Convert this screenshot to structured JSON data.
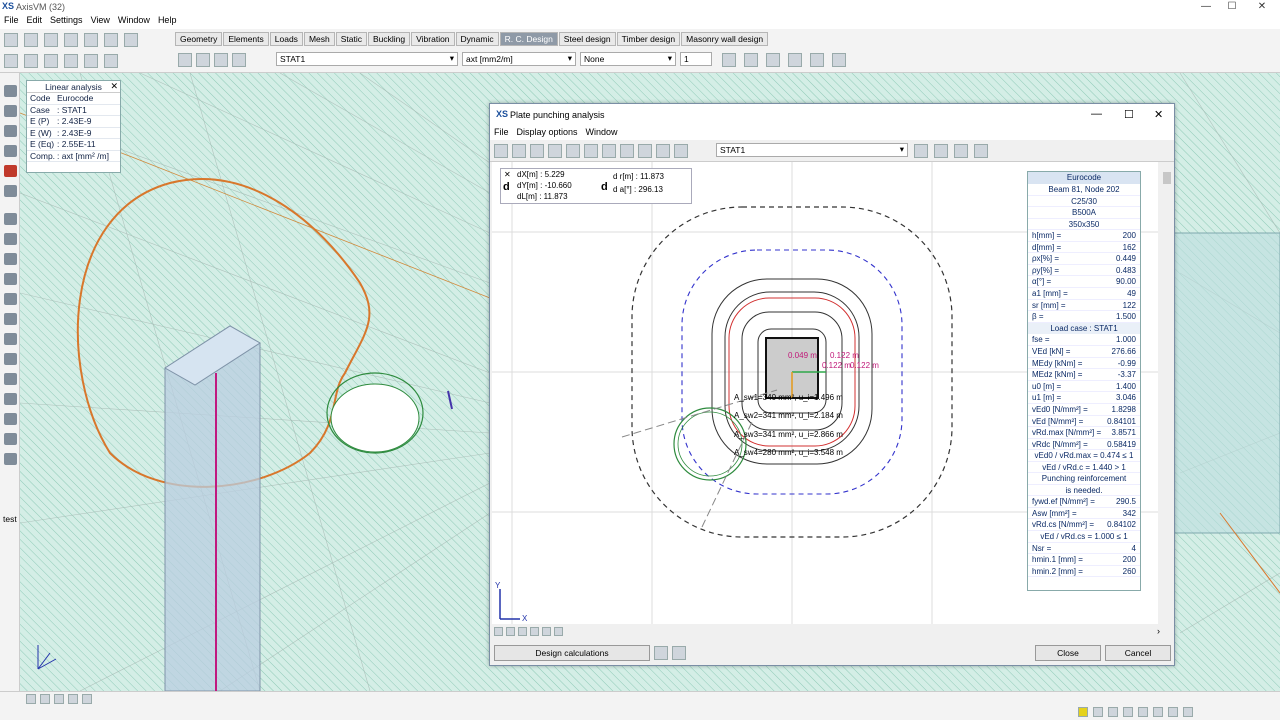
{
  "app": {
    "title": "AxisVM (32)",
    "window_buttons": [
      "—",
      "☐",
      "✕"
    ]
  },
  "menu": [
    "File",
    "Edit",
    "Settings",
    "View",
    "Window",
    "Help"
  ],
  "tabs": [
    "Geometry",
    "Elements",
    "Loads",
    "Mesh",
    "Static",
    "Buckling",
    "Vibration",
    "Dynamic",
    "R. C. Design",
    "Steel design",
    "Timber design",
    "Masonry wall design"
  ],
  "active_tab": "R. C. Design",
  "toolbar": {
    "case_select": "STAT1",
    "component_select": "axt [mm2/m]",
    "option_select": "None",
    "spinner": "1"
  },
  "left_label": "test",
  "info": {
    "title": "Linear analysis",
    "rows": [
      {
        "k": "Code",
        "v": "Eurocode"
      },
      {
        "k": "Case",
        "v": ": STAT1"
      },
      {
        "k": "E (P)",
        "v": ": 2.43E-9"
      },
      {
        "k": "E (W)",
        "v": ": 2.43E-9"
      },
      {
        "k": "E (Eq)",
        "v": ": 2.55E-11"
      },
      {
        "k": "Comp.",
        "v": ": axt [mm² /m]"
      }
    ]
  },
  "dialog": {
    "title": "Plate punching analysis",
    "menu": [
      "File",
      "Display options",
      "Window"
    ],
    "case_select": "STAT1",
    "delta": {
      "dx": "dX[m] : 5.229",
      "dy": "dY[m] : -10.660",
      "dl": "dL[m] : 11.873",
      "dr": "d r[m] : 11.873",
      "da": "d a[°] : 296.13"
    },
    "labels": {
      "v1": "0.049 m",
      "v2": "0.122 m",
      "v3": "0.122 m",
      "v4": "0.122 m",
      "a1": "A_sw1=340 mm², u_i=1.496 m",
      "a2": "A_sw2=341 mm², u_i=2.184 m",
      "a3": "A_sw3=341 mm², u_i=2.866 m",
      "a4": "A_sw4=280 mm², u_i=3.548 m"
    },
    "axes": {
      "x": "X",
      "y": "Y"
    },
    "results": {
      "header": "Eurocode",
      "info": [
        "Beam 81, Node 202",
        "C25/30",
        "B500A",
        "350x350"
      ],
      "params": [
        [
          "h[mm] =",
          "200"
        ],
        [
          "d[mm] =",
          "162"
        ],
        [
          "ρx[%] =",
          "0.449"
        ],
        [
          "ρy[%] =",
          "0.483"
        ],
        [
          "α[°] =",
          "90.00"
        ],
        [
          "a1 [mm] =",
          "49"
        ],
        [
          "sr [mm] =",
          "122"
        ],
        [
          "β =",
          "1.500"
        ]
      ],
      "load_case": "Load case : STAT1",
      "loads": [
        [
          "fse =",
          "1.000"
        ],
        [
          "VEd [kN] =",
          "276.66"
        ],
        [
          "MEdy [kNm] =",
          "-0.99"
        ],
        [
          "MEdz [kNm] =",
          "-3.37"
        ],
        [
          "u0 [m] =",
          "1.400"
        ],
        [
          "u1 [m] =",
          "3.046"
        ],
        [
          "vEd0 [N/mm²] =",
          "1.8298"
        ],
        [
          "vEd [N/mm²] =",
          "0.84101"
        ],
        [
          "vRd.max [N/mm²] =",
          "3.8571"
        ],
        [
          "vRdc [N/mm²] =",
          "0.58419"
        ]
      ],
      "checks": [
        "vEd0 / vRd.max = 0.474 ≤ 1",
        "vEd / vRd.c = 1.440 > 1",
        "Punching reinforcement",
        "is needed."
      ],
      "reinf": [
        [
          "fywd.ef [N/mm²] =",
          "290.5"
        ],
        [
          "Asw [mm²] =",
          "342"
        ],
        [
          "vRd.cs [N/mm²] =",
          "0.84102"
        ]
      ],
      "check2": "vEd / vRd.cs = 1.000 ≤ 1",
      "tail": [
        [
          "Nsr =",
          "4"
        ],
        [
          "hmin.1 [mm] =",
          "200"
        ],
        [
          "hmin.2 [mm] =",
          "260"
        ]
      ]
    },
    "buttons": {
      "design": "Design calculations",
      "close": "Close",
      "cancel": "Cancel"
    }
  }
}
